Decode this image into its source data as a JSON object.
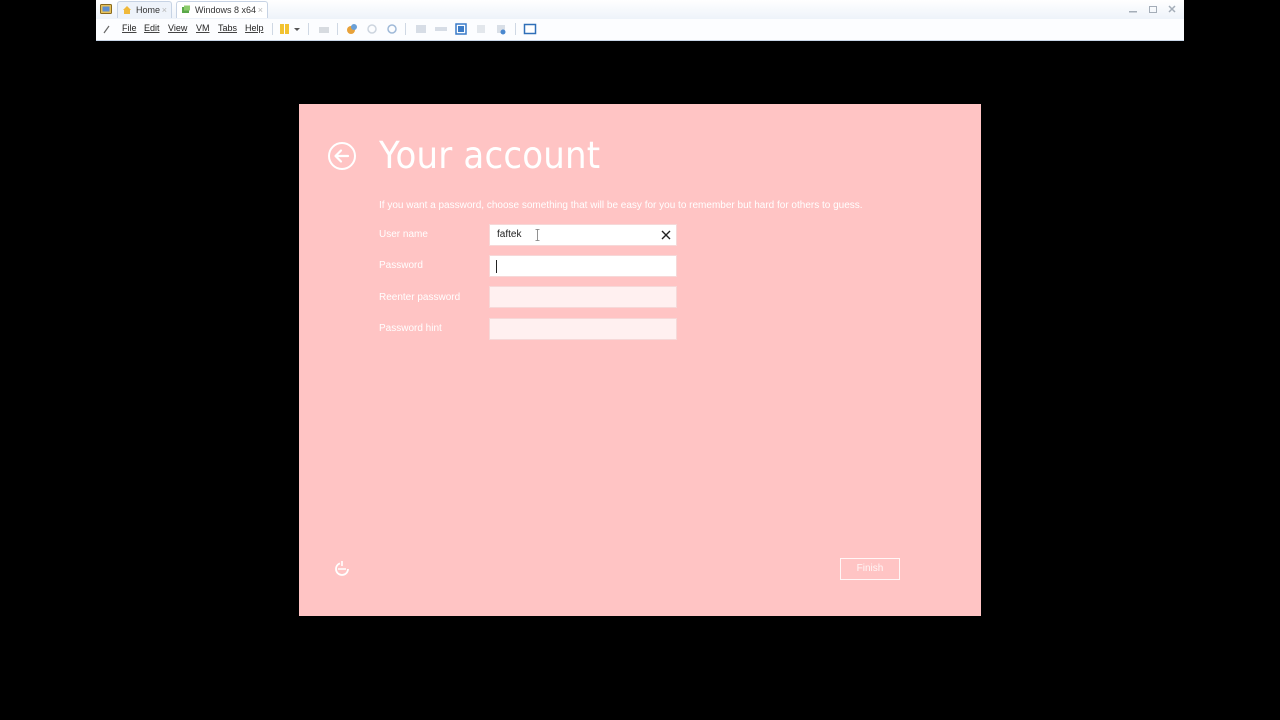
{
  "host": {
    "tabs": [
      {
        "label": "Home",
        "icon": "home-icon"
      },
      {
        "label": "Windows 8 x64",
        "icon": "vm-icon"
      }
    ],
    "tab_close_glyph": "×",
    "menu": [
      "File",
      "Edit",
      "View",
      "VM",
      "Tabs",
      "Help"
    ],
    "window_controls": [
      "minimize-icon",
      "restore-icon",
      "close-icon"
    ]
  },
  "setup": {
    "title": "Your account",
    "description": "If you want a password, choose something that will be easy for you to remember but hard for others to guess.",
    "fields": [
      {
        "label": "User name",
        "value": "faftek"
      },
      {
        "label": "Password",
        "value": ""
      },
      {
        "label": "Reenter password",
        "value": ""
      },
      {
        "label": "Password hint",
        "value": ""
      }
    ],
    "finish_label": "Finish",
    "background_color": "#ffc4c4"
  }
}
